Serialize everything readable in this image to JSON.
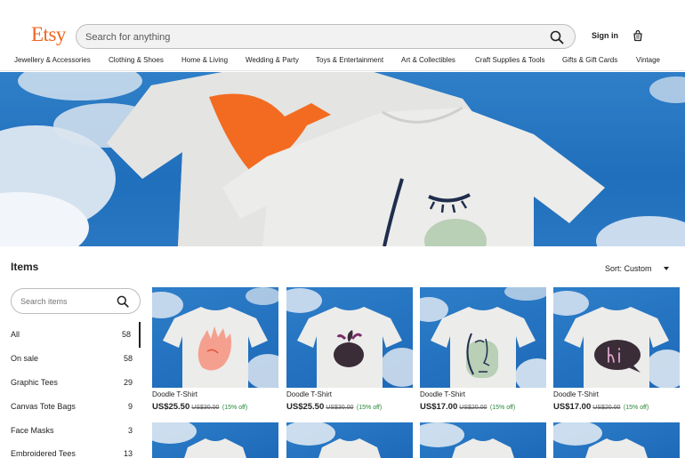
{
  "header": {
    "logo": "Etsy",
    "search_placeholder": "Search for anything",
    "sign_in": "Sign in",
    "nav": [
      "Jewellery & Accessories",
      "Clothing & Shoes",
      "Home & Living",
      "Wedding & Party",
      "Toys & Entertainment",
      "Art & Collectibles",
      "Craft Supplies & Tools",
      "Gifts & Gift Cards",
      "Vintage"
    ]
  },
  "items": {
    "title": "Items",
    "sort_label": "Sort: Custom",
    "search_placeholder": "Search items",
    "categories": [
      {
        "label": "All",
        "count": "58"
      },
      {
        "label": "On sale",
        "count": "58"
      },
      {
        "label": "Graphic Tees",
        "count": "29"
      },
      {
        "label": "Canvas Tote Bags",
        "count": "9"
      },
      {
        "label": "Face Masks",
        "count": "3"
      },
      {
        "label": "Embroidered Tees",
        "count": "13"
      }
    ]
  },
  "products": [
    {
      "name": "Doodle T-Shirt",
      "price": "US$25.50",
      "original": "US$30.00",
      "discount": "(15% off)",
      "design": "hand"
    },
    {
      "name": "Doodle T-Shirt",
      "price": "US$25.50",
      "original": "US$30.00",
      "discount": "(15% off)",
      "design": "apple"
    },
    {
      "name": "Doodle T-Shirt",
      "price": "US$17.00",
      "original": "US$20.00",
      "discount": "(15% off)",
      "design": "face"
    },
    {
      "name": "Doodle T-Shirt",
      "price": "US$17.00",
      "original": "US$20.00",
      "discount": "(15% off)",
      "design": "hi"
    }
  ],
  "colors": {
    "brand": "#f1641e",
    "sale_green": "#258635",
    "sky": "#1f6fbc"
  }
}
